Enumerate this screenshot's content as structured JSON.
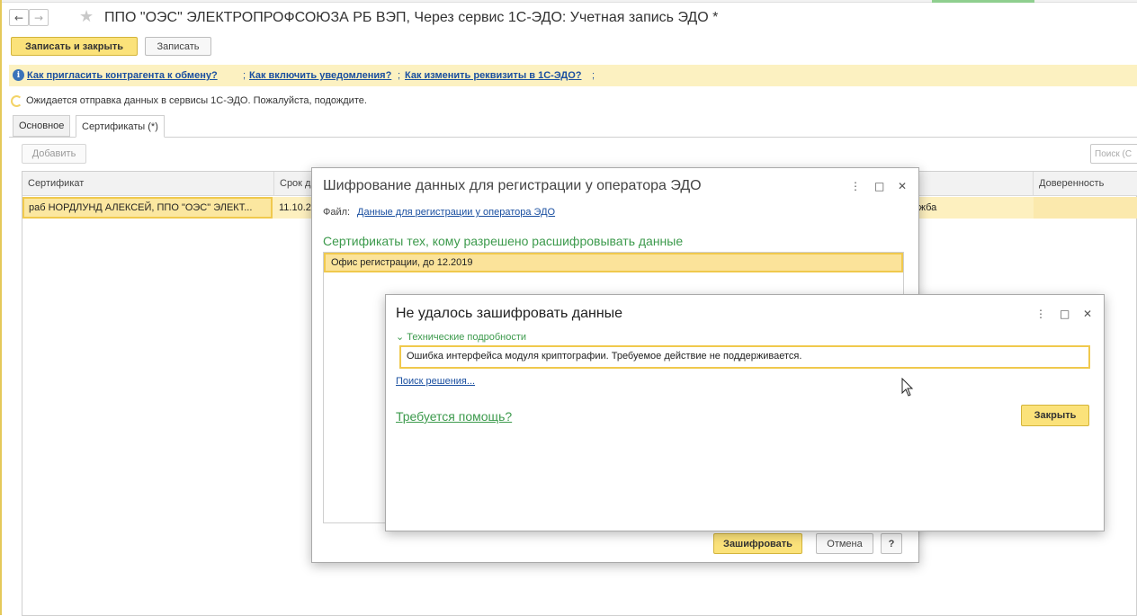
{
  "header": {
    "back_icon": "←",
    "forward_icon": "→",
    "star_icon": "★",
    "title": "ППО \"ОЭС\" ЭЛЕКТРОПРОФСОЮЗА РБ ВЭП, Через сервис 1С-ЭДО: Учетная запись ЭДО *"
  },
  "toolbar": {
    "save_close_label": "Записать и закрыть",
    "save_label": "Записать"
  },
  "info_bar": {
    "icon": "i",
    "links": [
      "Как пригласить контрагента к обмену?",
      "Как включить уведомления?",
      "Как изменить реквизиты в 1С-ЭДО?"
    ],
    "separator": ";"
  },
  "status": {
    "waiting_text": "Ожидается отправка данных в сервисы 1С-ЭДО. Пожалуйста, подождите."
  },
  "tabs": [
    {
      "label": "Основное"
    },
    {
      "label": "Сертификаты (*)"
    }
  ],
  "certs_panel": {
    "add_label": "Добавить",
    "search_placeholder": "Поиск (С",
    "columns": [
      "Сертификат",
      "Срок д",
      "",
      "Доверенность"
    ],
    "rows": [
      {
        "certificate": "раб НОРДЛУНД АЛЕКСЕЙ, ППО \"ОЭС\" ЭЛЕКТ...",
        "term": "11.10.2",
        "service": "ужба",
        "proxy": ""
      }
    ]
  },
  "encrypt_dialog": {
    "title": "Шифрование данных для регистрации у оператора ЭДО",
    "file_label": "Файл:",
    "file_link": "Данные для регистрации у оператора ЭДО",
    "section_title": "Сертификаты тех, кому разрешено расшифровывать данные",
    "items": [
      "Офис регистрации, до 12.2019"
    ],
    "encrypt_label": "Зашифровать",
    "cancel_label": "Отмена",
    "help_label": "?",
    "menu_icon": "⋮",
    "maximize_icon": "□",
    "close_icon": "✕"
  },
  "error_dialog": {
    "title": "Не удалось зашифровать данные",
    "details_toggle": "Технические подробности",
    "details_arrow": "⌄",
    "error_text": "Ошибка интерфейса модуля криптографии. Требуемое действие не поддерживается.",
    "search_link": "Поиск решения...",
    "help_link": "Требуется помощь?",
    "close_label": "Закрыть",
    "menu_icon": "⋮",
    "maximize_icon": "□",
    "close_icon": "✕"
  },
  "colors": {
    "accent_yellow": "#fbe27a",
    "row_highlight": "#fdf0bf",
    "info_bg": "#fcf1c1",
    "link_blue": "#1a4fa0",
    "green_text": "#3c9a4c"
  }
}
